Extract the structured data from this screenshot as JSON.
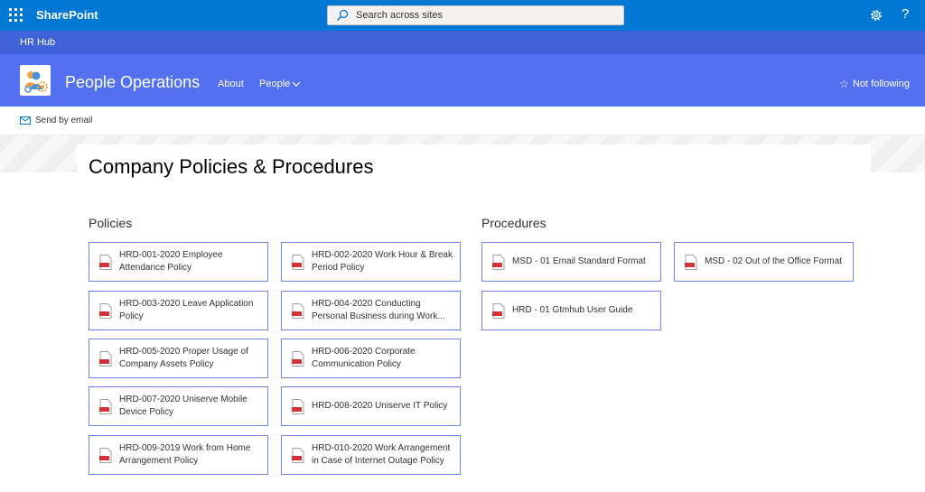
{
  "suite": {
    "brand": "SharePoint",
    "search_placeholder": "Search across sites"
  },
  "hub": {
    "title": "HR Hub"
  },
  "site": {
    "title": "People Operations",
    "nav": [
      {
        "label": "About"
      },
      {
        "label": "People"
      }
    ],
    "follow_label": "Not following"
  },
  "commands": {
    "send_by_email": "Send by email"
  },
  "page": {
    "title": "Company Policies & Procedures"
  },
  "policies": {
    "heading": "Policies",
    "items": [
      {
        "label": "HRD-001-2020 Employee Attendance Policy"
      },
      {
        "label": "HRD-002-2020 Work Hour & Break Period Policy"
      },
      {
        "label": "HRD-003-2020 Leave Application Policy"
      },
      {
        "label": "HRD-004-2020 Conducting Personal Business during Work..."
      },
      {
        "label": "HRD-005-2020 Proper Usage of Company Assets Policy"
      },
      {
        "label": "HRD-006-2020 Corporate Communication Policy"
      },
      {
        "label": "HRD-007-2020 Uniserve Mobile Device Policy"
      },
      {
        "label": "HRD-008-2020 Uniserve IT Policy"
      },
      {
        "label": "HRD-009-2019 Work from Home Arrangement Policy"
      },
      {
        "label": "HRD-010-2020 Work Arrangement in Case of Internet Outage Policy"
      }
    ]
  },
  "procedures": {
    "heading": "Procedures",
    "items": [
      {
        "label": "MSD - 01 Email Standard Format"
      },
      {
        "label": "MSD - 02 Out of the Office Format"
      },
      {
        "label": "HRD - 01 Gtmhub User Guide"
      }
    ]
  },
  "colors": {
    "suite_bar": "#0078d4",
    "hub_bar": "#4062d8",
    "site_header": "#5270ef",
    "card_border": "#6f86e8"
  }
}
